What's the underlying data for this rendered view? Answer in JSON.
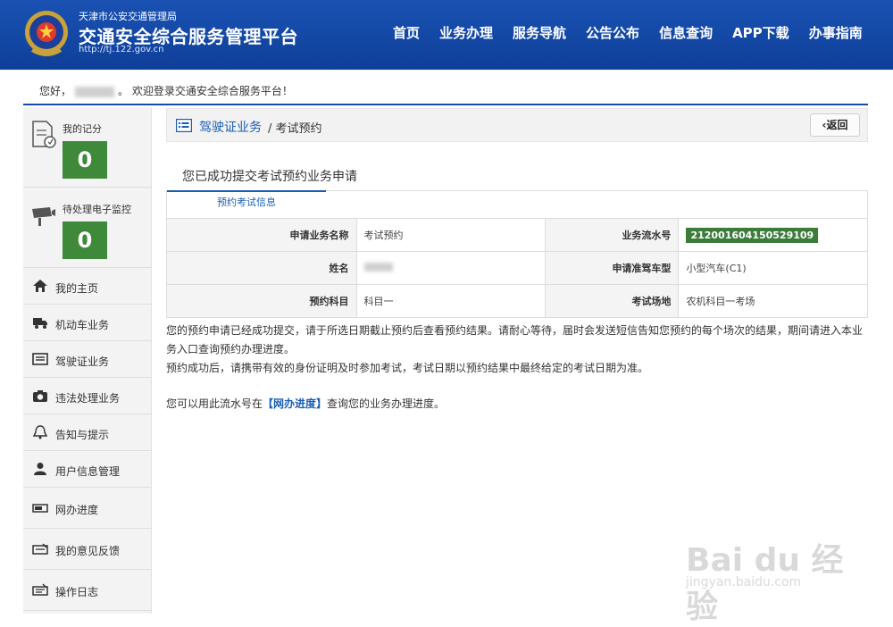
{
  "header": {
    "org_name": "天津市公安交通管理局",
    "platform_title": "交通安全综合服务管理平台",
    "site_url": "http://tj.122.gov.cn",
    "nav": [
      "首页",
      "业务办理",
      "服务导航",
      "公告公布",
      "信息查询",
      "APP下载",
      "办事指南"
    ]
  },
  "welcome": {
    "prefix": "您好，",
    "suffix": "。 欢迎登录交通安全综合服务平台！"
  },
  "sidebar": {
    "score": {
      "label": "我的记分",
      "value": "0"
    },
    "pending": {
      "label": "待处理电子监控",
      "value": "0"
    },
    "items": [
      {
        "label": "我的主页",
        "icon": "home-icon"
      },
      {
        "label": "机动车业务",
        "icon": "truck-icon"
      },
      {
        "label": "驾驶证业务",
        "icon": "license-card-icon"
      },
      {
        "label": "违法处理业务",
        "icon": "camera-icon"
      },
      {
        "label": "告知与提示",
        "icon": "bell-icon"
      },
      {
        "label": "用户信息管理",
        "icon": "user-icon"
      },
      {
        "label": "网办进度",
        "icon": "progress-icon"
      },
      {
        "label": "我的意见反馈",
        "icon": "feedback-icon"
      },
      {
        "label": "操作日志",
        "icon": "log-icon"
      }
    ]
  },
  "breadcrumb": {
    "main": "驾驶证业务",
    "separator": "/ 考试预约",
    "back_label": "返回"
  },
  "main": {
    "success_title": "您已成功提交考试预约业务申请",
    "tab_label": "预约考试信息",
    "table": {
      "r1": {
        "k1": "申请业务名称",
        "v1": "考试预约",
        "k2": "业务流水号",
        "v2": "212001604150529109"
      },
      "r2": {
        "k1": "姓名",
        "k2": "申请准驾车型",
        "v2": "小型汽车(C1)"
      },
      "r3": {
        "k1": "预约科目",
        "v1": "科目一",
        "k2": "考试场地",
        "v2": "农机科目一考场"
      }
    },
    "note1": "您的预约申请已经成功提交，请于所选日期截止预约后查看预约结果。请耐心等待，届时会发送短信告知您预约的每个场次的结果，期间请进入本业务入口查询预约办理进度。",
    "note2": "预约成功后，请携带有效的身份证明及时参加考试，考试日期以预约结果中最终给定的考试日期为准。",
    "progress_prefix": "您可以用此流水号在",
    "progress_link": "【网办进度】",
    "progress_suffix": "查询您的业务办理进度。"
  },
  "watermark": {
    "main": "Bai du 经验",
    "sub": "jingyan.baidu.com"
  }
}
